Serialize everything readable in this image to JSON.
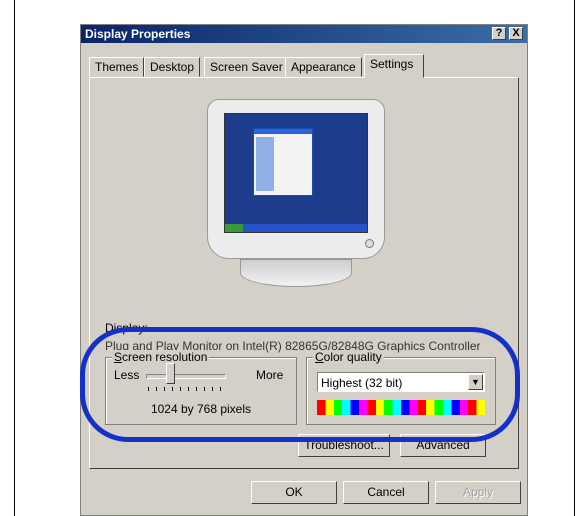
{
  "window": {
    "title": "Display Properties",
    "help_label": "?",
    "close_label": "X"
  },
  "tabs": [
    {
      "label": "Themes"
    },
    {
      "label": "Desktop"
    },
    {
      "label": "Screen Saver"
    },
    {
      "label": "Appearance"
    },
    {
      "label": "Settings"
    }
  ],
  "active_tab": "Settings",
  "display": {
    "label": "Display:",
    "value": "Plug and Play Monitor on Intel(R) 82865G/82848G Graphics Controller"
  },
  "screen_resolution": {
    "label_underlined": "S",
    "label_rest": "creen resolution",
    "less_label": "Less",
    "more_label": "More",
    "value_text": "1024 by 768 pixels",
    "slider_position_fraction": 0.3
  },
  "color_quality": {
    "label_underlined": "C",
    "label_rest": "olor quality",
    "selected": "Highest (32 bit)"
  },
  "buttons": {
    "troubleshoot": "Troubleshoot...",
    "advanced": "Advanced",
    "ok": "OK",
    "cancel": "Cancel",
    "apply": "Apply"
  },
  "colors": {
    "highlight": "#1530c8",
    "titlebar": "#0a246a",
    "dialog_bg": "#d4d0c8"
  }
}
